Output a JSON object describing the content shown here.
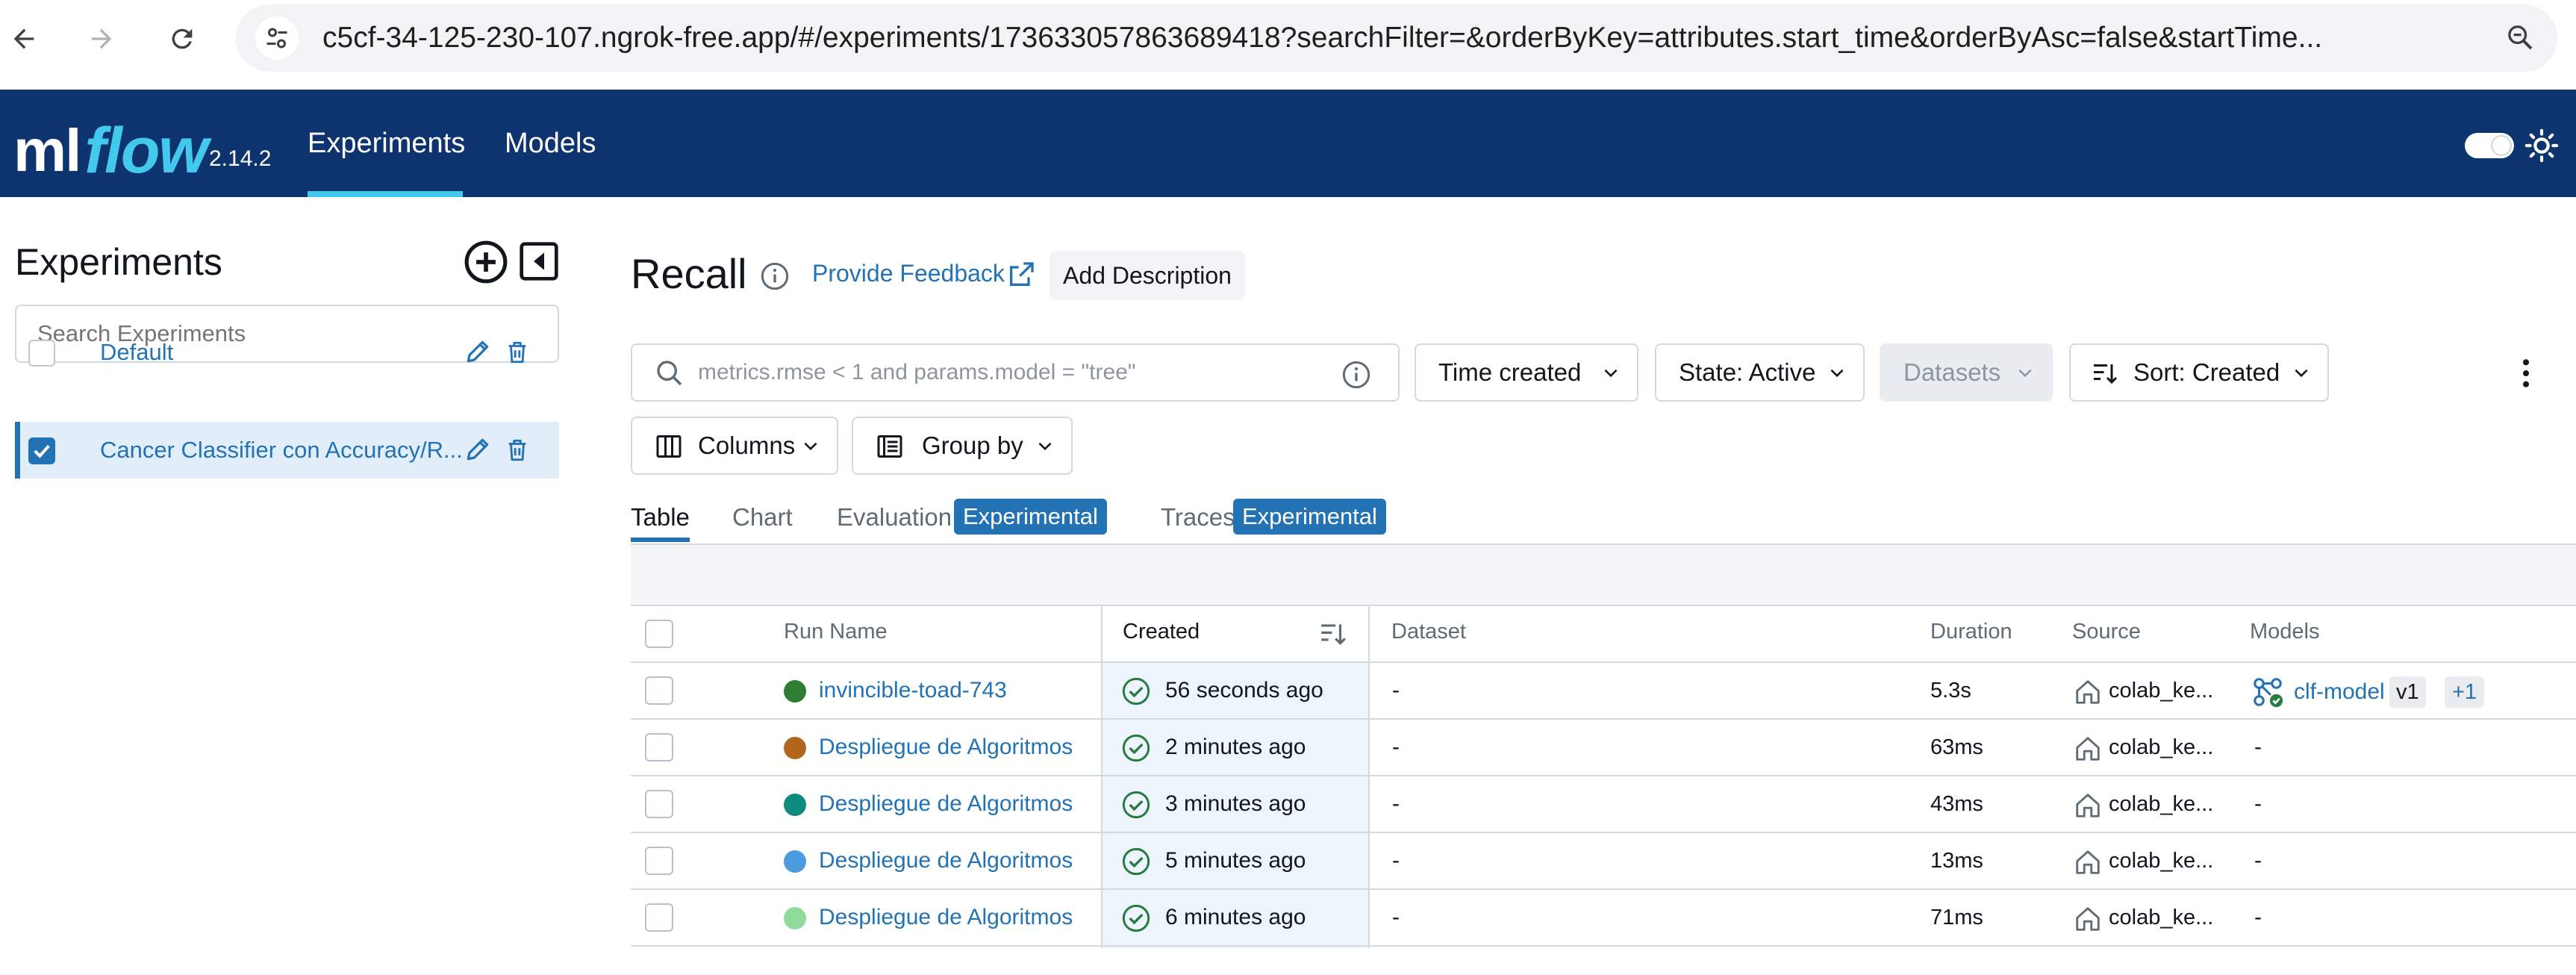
{
  "browser": {
    "url": "c5cf-34-125-230-107.ngrok-free.app/#/experiments/173633057863689418?searchFilter=&orderByKey=attributes.start_time&orderByAsc=false&startTime..."
  },
  "header": {
    "logo_ml": "ml",
    "logo_flow": "flow",
    "version": "2.14.2",
    "nav": [
      "Experiments",
      "Models"
    ],
    "brand_color": "#0e3470",
    "accent_color": "#43c9ed"
  },
  "sidebar": {
    "title": "Experiments",
    "search_placeholder": "Search Experiments",
    "experiments": [
      {
        "name": "Default",
        "selected": false
      },
      {
        "name": "Cancer Classifier con Accuracy/R...",
        "selected": true
      }
    ]
  },
  "main": {
    "title": "Recall",
    "feedback_label": "Provide Feedback",
    "add_description_label": "Add Description",
    "search_placeholder": "metrics.rmse < 1 and params.model = \"tree\"",
    "filters": {
      "time_created": "Time created",
      "state": "State: Active",
      "datasets": "Datasets",
      "sort": "Sort: Created",
      "columns": "Columns",
      "group_by": "Group by"
    },
    "tabs": {
      "table": "Table",
      "chart": "Chart",
      "evaluation": "Evaluation",
      "traces": "Traces",
      "experimental_badge": "Experimental"
    }
  },
  "table": {
    "columns": {
      "run_name": "Run Name",
      "created": "Created",
      "dataset": "Dataset",
      "duration": "Duration",
      "source": "Source",
      "models": "Models"
    },
    "rows": [
      {
        "name": "invincible-toad-743",
        "color": "#2e7d32",
        "created": "56 seconds ago",
        "dataset": "-",
        "duration": "5.3s",
        "source": "colab_ke...",
        "model": "clf-model",
        "version": "v1",
        "more": "+1"
      },
      {
        "name": "Despliegue de Algoritmos",
        "color": "#b0661c",
        "created": "2 minutes ago",
        "dataset": "-",
        "duration": "63ms",
        "source": "colab_ke...",
        "models": "-"
      },
      {
        "name": "Despliegue de Algoritmos",
        "color": "#0f8a7e",
        "created": "3 minutes ago",
        "dataset": "-",
        "duration": "43ms",
        "source": "colab_ke...",
        "models": "-"
      },
      {
        "name": "Despliegue de Algoritmos",
        "color": "#4a9be0",
        "created": "5 minutes ago",
        "dataset": "-",
        "duration": "13ms",
        "source": "colab_ke...",
        "models": "-"
      },
      {
        "name": "Despliegue de Algoritmos",
        "color": "#8fdc9a",
        "created": "6 minutes ago",
        "dataset": "-",
        "duration": "71ms",
        "source": "colab_ke...",
        "models": "-"
      }
    ]
  }
}
